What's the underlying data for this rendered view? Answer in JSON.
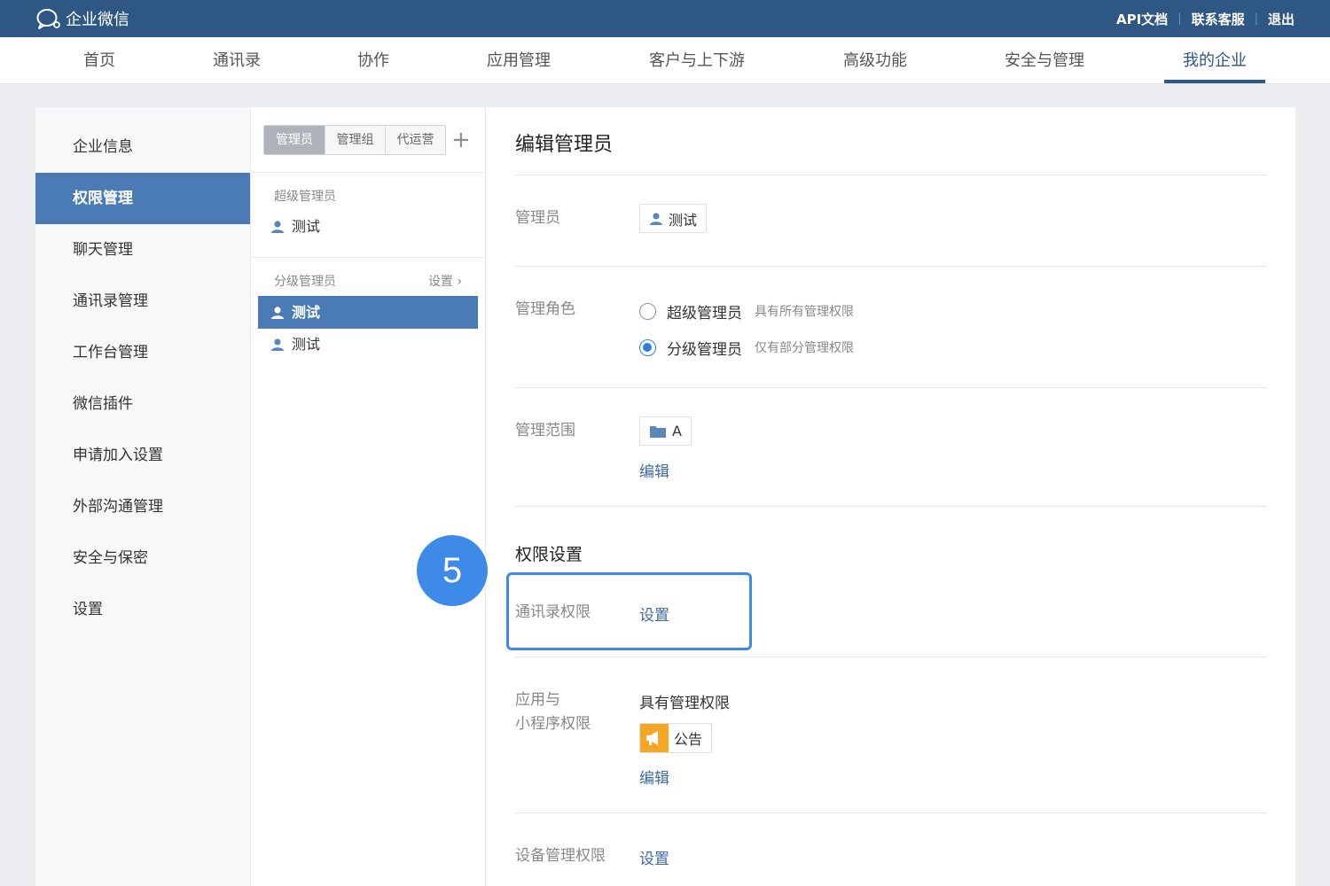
{
  "topbar": {
    "brand": "企业微信",
    "links": [
      "API文档",
      "联系客服",
      "退出"
    ]
  },
  "nav": {
    "items": [
      "首页",
      "通讯录",
      "协作",
      "应用管理",
      "客户与上下游",
      "高级功能",
      "安全与管理",
      "我的企业"
    ],
    "active_index": 7
  },
  "left_menu": {
    "items": [
      "企业信息",
      "权限管理",
      "聊天管理",
      "通讯录管理",
      "工作台管理",
      "微信插件",
      "申请加入设置",
      "外部沟通管理",
      "安全与保密",
      "设置"
    ],
    "active_index": 1
  },
  "mid": {
    "tabs": [
      "管理员",
      "管理组",
      "代运营"
    ],
    "plus": "+",
    "super_admin_label": "超级管理员",
    "super_admin_user": "测试",
    "sub_admin_label": "分级管理员",
    "sub_admin_setting": "设置 ›",
    "sub_admin_users": [
      "测试",
      "测试"
    ]
  },
  "content": {
    "title": "编辑管理员",
    "admin_label": "管理员",
    "admin_value": "测试",
    "role_label": "管理角色",
    "roles": [
      {
        "name": "超级管理员",
        "desc": "具有所有管理权限",
        "checked": false
      },
      {
        "name": "分级管理员",
        "desc": "仅有部分管理权限",
        "checked": true
      }
    ],
    "scope_label": "管理范围",
    "scope_value": "A",
    "scope_edit": "编辑",
    "perm_title": "权限设置",
    "contacts_perm_label": "通讯录权限",
    "contacts_perm_action": "设置",
    "app_perm_label_1": "应用与",
    "app_perm_label_2": "小程序权限",
    "app_perm_value": "具有管理权限",
    "app_name": "公告",
    "app_edit": "编辑",
    "device_perm_label": "设备管理权限",
    "device_perm_action": "设置"
  },
  "annotation": {
    "step": "5"
  },
  "colors": {
    "topbar": "#2e5784",
    "active_menu": "#4b7bb4",
    "link": "#3d6aa0",
    "highlight": "#3e8ae8",
    "app_icon": "#f5a623"
  }
}
